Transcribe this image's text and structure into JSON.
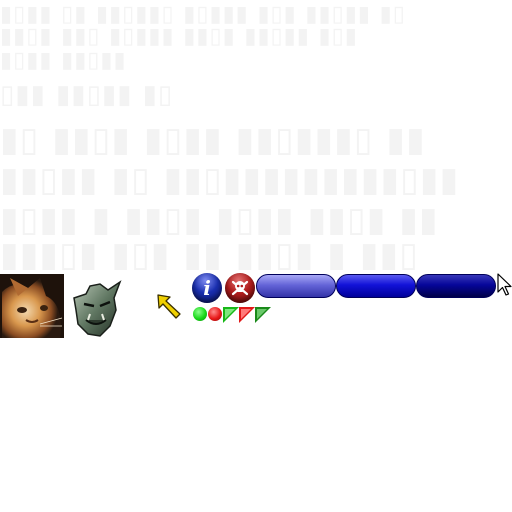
{
  "toolbar": {
    "info_glyph": "i",
    "icons": [
      "cat-avatar",
      "orc-head-icon",
      "yellow-arrow-icon",
      "info-icon",
      "skull-crossbones-icon",
      "mouse-pointer-icon"
    ],
    "pills": [
      "",
      "",
      ""
    ],
    "status_markers": [
      "green-dot",
      "red-dot",
      "green-triangle",
      "red-triangle",
      "green-triangle"
    ]
  },
  "colors": {
    "pill_light": "#6565d8",
    "pill_mid": "#1212d8",
    "pill_dark": "#06069a",
    "info_orb": "#1a2fb0",
    "danger_orb": "#b21d1d",
    "green": "#18d818",
    "red": "#e81818",
    "arrow": "#f0d000"
  }
}
